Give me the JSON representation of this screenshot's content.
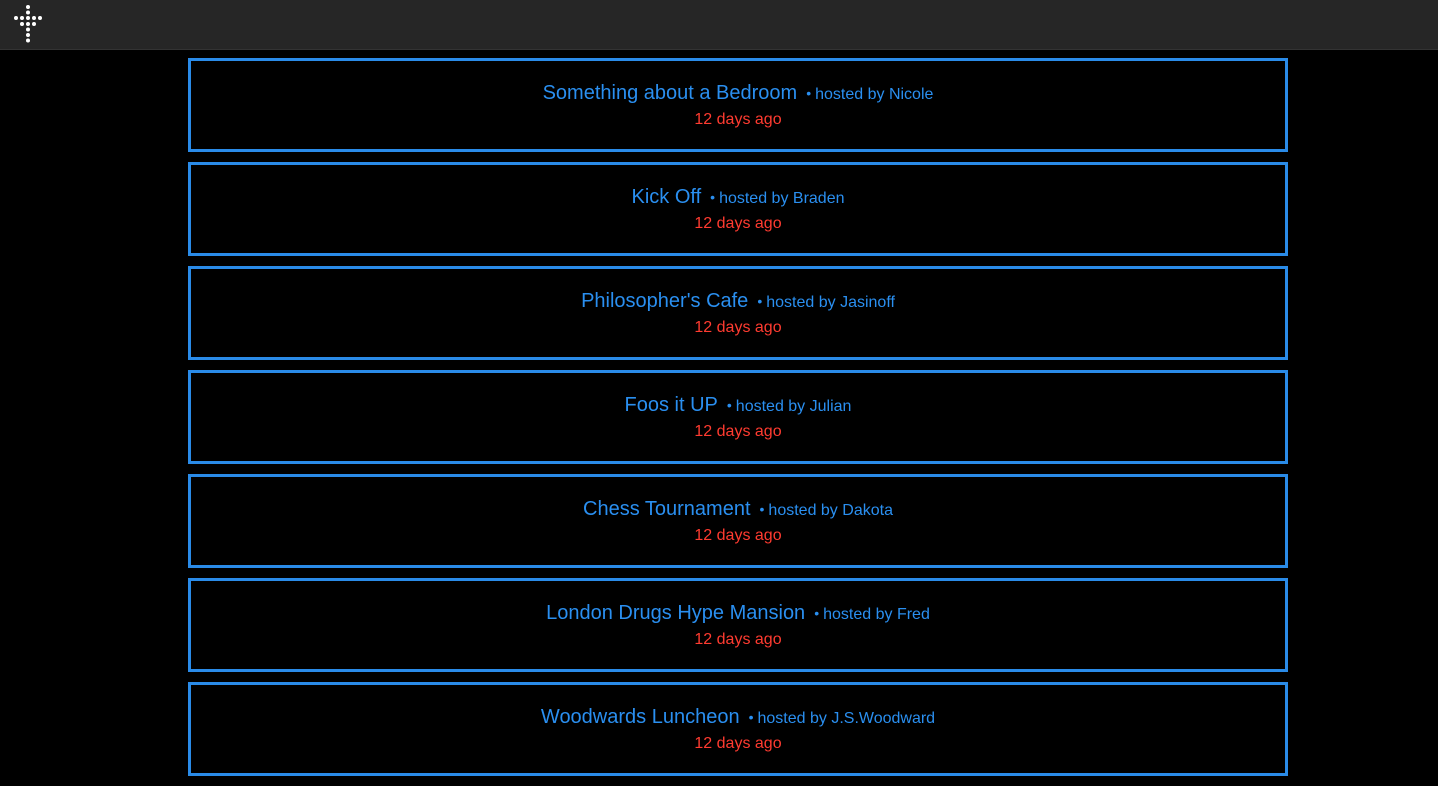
{
  "header": {
    "logo_icon": "dotted-cross-logo-icon"
  },
  "colors": {
    "background": "#000000",
    "header_background": "#262626",
    "card_border": "#2a8be8",
    "title_text": "#2a8ff0",
    "time_text": "#ff3b30"
  },
  "events": [
    {
      "title": "Something about a Bedroom",
      "separator": "•",
      "host_prefix": "hosted by",
      "host": "Nicole",
      "time": "12 days ago"
    },
    {
      "title": "Kick Off",
      "separator": "•",
      "host_prefix": "hosted by",
      "host": "Braden",
      "time": "12 days ago"
    },
    {
      "title": "Philosopher's Cafe",
      "separator": "•",
      "host_prefix": "hosted by",
      "host": "Jasinoff",
      "time": "12 days ago"
    },
    {
      "title": "Foos it UP",
      "separator": "•",
      "host_prefix": "hosted by",
      "host": "Julian",
      "time": "12 days ago"
    },
    {
      "title": "Chess Tournament",
      "separator": "•",
      "host_prefix": "hosted by",
      "host": "Dakota",
      "time": "12 days ago"
    },
    {
      "title": "London Drugs Hype Mansion",
      "separator": "•",
      "host_prefix": "hosted by",
      "host": "Fred",
      "time": "12 days ago"
    },
    {
      "title": "Woodwards Luncheon",
      "separator": "•",
      "host_prefix": "hosted by",
      "host": "J.S.Woodward",
      "time": "12 days ago"
    }
  ]
}
